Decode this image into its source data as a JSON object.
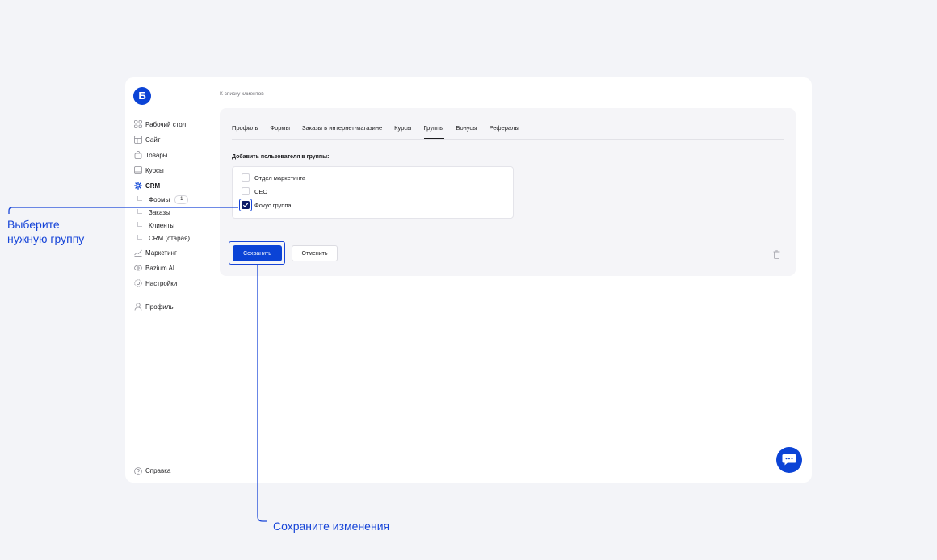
{
  "app": {
    "logo_letter": "Б"
  },
  "sidebar": {
    "items": [
      {
        "label": "Рабочий стол",
        "icon": "dashboard-icon"
      },
      {
        "label": "Сайт",
        "icon": "site-icon"
      },
      {
        "label": "Товары",
        "icon": "bag-icon"
      },
      {
        "label": "Курсы",
        "icon": "book-icon"
      },
      {
        "label": "CRM",
        "icon": "crm-icon",
        "active": true
      }
    ],
    "crm_sub": [
      {
        "label": "Формы",
        "badge": "1"
      },
      {
        "label": "Заказы"
      },
      {
        "label": "Клиенты"
      },
      {
        "label": "CRM (старая)"
      }
    ],
    "items_after": [
      {
        "label": "Маркетинг",
        "icon": "chart-icon"
      },
      {
        "label": "Bazium AI",
        "icon": "ai-icon"
      },
      {
        "label": "Настройки",
        "icon": "gear-icon"
      }
    ],
    "profile": {
      "label": "Профиль",
      "icon": "user-icon"
    },
    "help": {
      "label": "Справка",
      "icon": "help-icon"
    }
  },
  "breadcrumb": "К списку клиентов",
  "tabs": [
    {
      "label": "Профиль"
    },
    {
      "label": "Формы"
    },
    {
      "label": "Заказы в интернет-магазине"
    },
    {
      "label": "Курсы"
    },
    {
      "label": "Группы",
      "active": true
    },
    {
      "label": "Бонусы"
    },
    {
      "label": "Рефералы"
    }
  ],
  "groups": {
    "title": "Добавить пользователя в группы:",
    "items": [
      {
        "label": "Отдел маркетинга",
        "checked": false
      },
      {
        "label": "CEO",
        "checked": false
      },
      {
        "label": "Фокус группа",
        "checked": true
      }
    ]
  },
  "actions": {
    "save_label": "Сохранить",
    "cancel_label": "Отменить"
  },
  "annotations": {
    "select_group_line1": "Выберите",
    "select_group_line2": "нужную группу",
    "save_changes": "Сохраните изменения"
  },
  "colors": {
    "accent": "#0b43d6",
    "annotation": "#1745d8",
    "checkbox_checked": "#0d1b66"
  }
}
